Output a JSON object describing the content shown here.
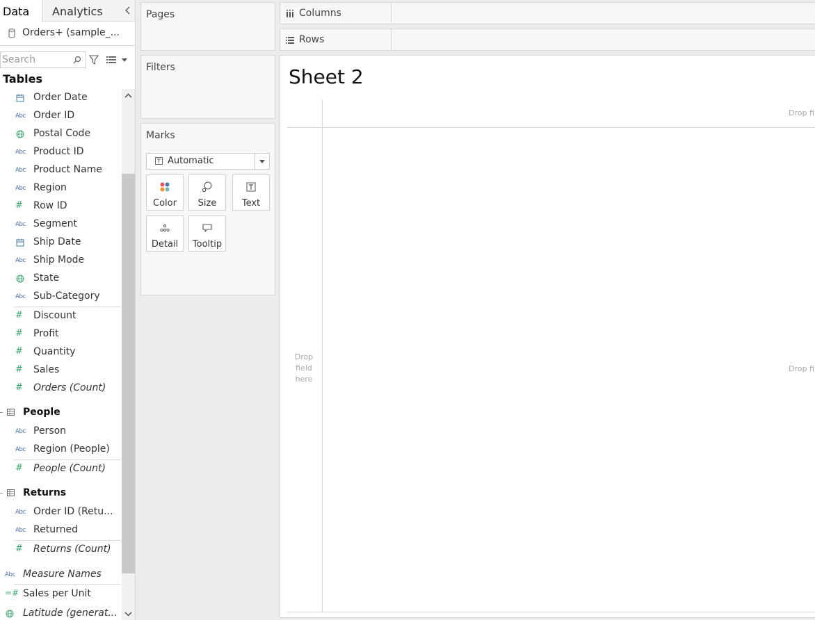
{
  "tabs": {
    "data": "Data",
    "analytics": "Analytics"
  },
  "datasource": {
    "name": "Orders+ (sample_..."
  },
  "search": {
    "placeholder": "Search"
  },
  "tables_header": "Tables",
  "orders_fields": [
    {
      "label": "Order Date",
      "type": "date"
    },
    {
      "label": "Order ID",
      "type": "abc"
    },
    {
      "label": "Postal Code",
      "type": "geo"
    },
    {
      "label": "Product ID",
      "type": "abc"
    },
    {
      "label": "Product Name",
      "type": "abc"
    },
    {
      "label": "Region",
      "type": "abc"
    },
    {
      "label": "Row ID",
      "type": "number"
    },
    {
      "label": "Segment",
      "type": "abc"
    },
    {
      "label": "Ship Date",
      "type": "date"
    },
    {
      "label": "Ship Mode",
      "type": "abc"
    },
    {
      "label": "State",
      "type": "geo"
    },
    {
      "label": "Sub-Category",
      "type": "abc"
    }
  ],
  "orders_measures": [
    {
      "label": "Discount",
      "type": "number"
    },
    {
      "label": "Profit",
      "type": "number"
    },
    {
      "label": "Quantity",
      "type": "number"
    },
    {
      "label": "Sales",
      "type": "number"
    },
    {
      "label": "Orders (Count)",
      "type": "number",
      "italic": true
    }
  ],
  "people_group": {
    "label": "People",
    "fields": [
      {
        "label": "Person",
        "type": "abc"
      },
      {
        "label": "Region (People)",
        "type": "abc"
      }
    ],
    "measures": [
      {
        "label": "People (Count)",
        "type": "number",
        "italic": true
      }
    ]
  },
  "returns_group": {
    "label": "Returns",
    "fields": [
      {
        "label": "Order ID (Retu...",
        "type": "abc"
      },
      {
        "label": "Returned",
        "type": "abc"
      }
    ],
    "measures": [
      {
        "label": "Returns (Count)",
        "type": "number",
        "italic": true
      }
    ]
  },
  "top_fields": [
    {
      "label": "Measure Names",
      "type": "abc",
      "italic": true
    },
    {
      "label": "Sales per Unit",
      "type": "calc"
    },
    {
      "label": "Latitude (generat...",
      "type": "geo",
      "italic": true
    }
  ],
  "cards": {
    "pages": "Pages",
    "filters": "Filters",
    "marks": "Marks"
  },
  "marks": {
    "type": "Automatic",
    "buttons": [
      "Color",
      "Size",
      "Text",
      "Detail",
      "Tooltip"
    ]
  },
  "shelves": {
    "columns": "Columns",
    "rows": "Rows"
  },
  "sheet": {
    "title": "Sheet 2",
    "drop_top": "Drop fi",
    "drop_left": "Drop field here",
    "drop_center": "Drop fi"
  },
  "colors": {
    "abc_icon": "#4a6fa5",
    "number_icon": "#3aa76d",
    "geo_icon": "#3aa76d",
    "date_icon": "#3a7aa7"
  }
}
